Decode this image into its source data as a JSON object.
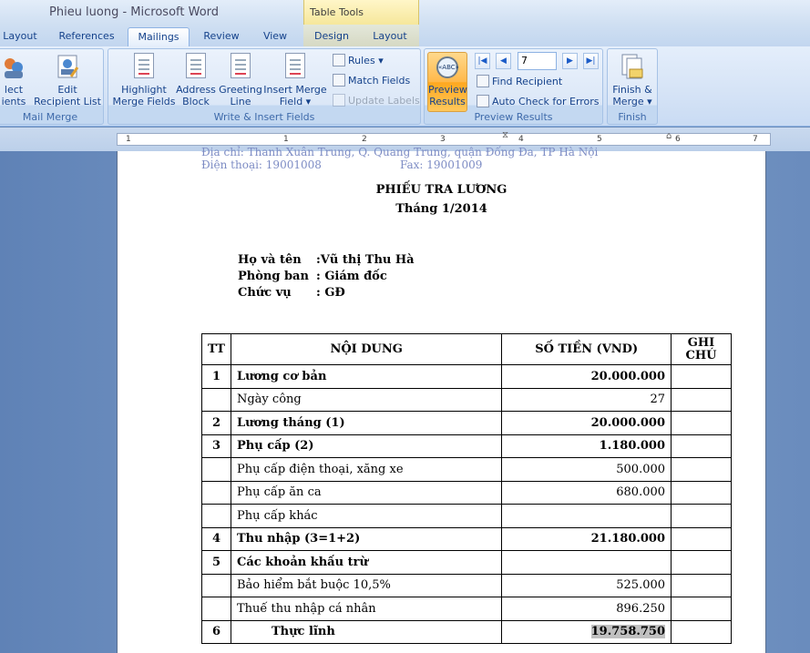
{
  "window": {
    "title": "Phieu luong - Microsoft Word",
    "context_tab": "Table Tools"
  },
  "tabs": [
    "Layout",
    "References",
    "Mailings",
    "Review",
    "View",
    "Design",
    "Layout"
  ],
  "active_tab": "Mailings",
  "ribbon": {
    "start_group": {
      "select_label_1": "lect",
      "select_label_2": "ients",
      "edit_label_1": "Edit",
      "edit_label_2": "Recipient List",
      "group_label": "Mail Merge"
    },
    "write_group": {
      "highlight_1": "Highlight",
      "highlight_2": "Merge Fields",
      "address_1": "Address",
      "address_2": "Block",
      "greeting_1": "Greeting",
      "greeting_2": "Line",
      "insert_1": "Insert Merge",
      "insert_2": "Field",
      "rules": "Rules",
      "match_fields": "Match Fields",
      "update_labels": "Update Labels",
      "group_label": "Write & Insert Fields"
    },
    "preview_group": {
      "preview_1": "Preview",
      "preview_2": "Results",
      "lens_text": "«ABC»",
      "record_number": "7",
      "find_recipient": "Find Recipient",
      "auto_check": "Auto Check for Errors",
      "group_label": "Preview Results"
    },
    "finish_group": {
      "finish_1": "Finish &",
      "finish_2": "Merge",
      "group_label": "Finish"
    }
  },
  "ruler": {
    "numbers": [
      "1",
      "1",
      "2",
      "3",
      "4",
      "5",
      "6",
      "7"
    ]
  },
  "document": {
    "header_address": "Địa chỉ: Thanh Xuân Trung, Q. Quang Trung, quận Đống Đa, TP Hà Nội",
    "header_phone": "Điện thoại: 19001008",
    "header_fax": "Fax: 19001009",
    "title": "PHIẾU TRA LƯƠNG",
    "subtitle": "Tháng 1/2014",
    "info": [
      {
        "label": "Họ và tên",
        "value": ":Vũ thị Thu Hà"
      },
      {
        "label": "Phòng ban",
        "value": ": Giám đốc"
      },
      {
        "label": "Chức vụ",
        "value": ": GĐ"
      }
    ],
    "table": {
      "headers": [
        "TT",
        "NỘI DUNG",
        "SỐ TIỀN (VND)",
        "GHI CHÚ"
      ],
      "rows": [
        {
          "tt": "1",
          "content": "Lương cơ bản",
          "amount": "20.000.000",
          "note": "",
          "bold": true
        },
        {
          "tt": "",
          "content": "Ngày công",
          "amount": "27",
          "note": "",
          "bold": false
        },
        {
          "tt": "2",
          "content": "Lương tháng (1)",
          "amount": "20.000.000",
          "note": "",
          "bold": true
        },
        {
          "tt": "3",
          "content": "Phụ cấp (2)",
          "amount": "1.180.000",
          "note": "",
          "bold": true
        },
        {
          "tt": "",
          "content": "Phụ cấp điện thoại, xăng xe",
          "amount": "500.000",
          "note": "",
          "bold": false
        },
        {
          "tt": "",
          "content": "Phụ cấp ăn ca",
          "amount": "680.000",
          "note": "",
          "bold": false
        },
        {
          "tt": "",
          "content": "Phụ cấp khác",
          "amount": "",
          "note": "",
          "bold": false
        },
        {
          "tt": "4",
          "content": "Thu nhập (3=1+2)",
          "amount": "21.180.000",
          "note": "",
          "bold": true
        },
        {
          "tt": "5",
          "content": "Các khoản khấu trừ",
          "amount": "",
          "note": "",
          "bold": true
        },
        {
          "tt": "",
          "content": "Bảo hiểm bắt buộc 10,5%",
          "amount": "525.000",
          "note": "",
          "bold": false
        },
        {
          "tt": "",
          "content": "Thuế thu nhập cá nhân",
          "amount": "896.250",
          "note": "",
          "bold": false
        },
        {
          "tt": "6",
          "content": "Thực lĩnh",
          "amount": "19.758.750",
          "note": "",
          "bold": true,
          "highlight_amount": true
        }
      ]
    }
  },
  "colors": {
    "ribbon_text": "#15428b",
    "active_button": "#ffb94a",
    "document_bg": "#ffffff",
    "workspace_bg": "#6b8bb8"
  }
}
